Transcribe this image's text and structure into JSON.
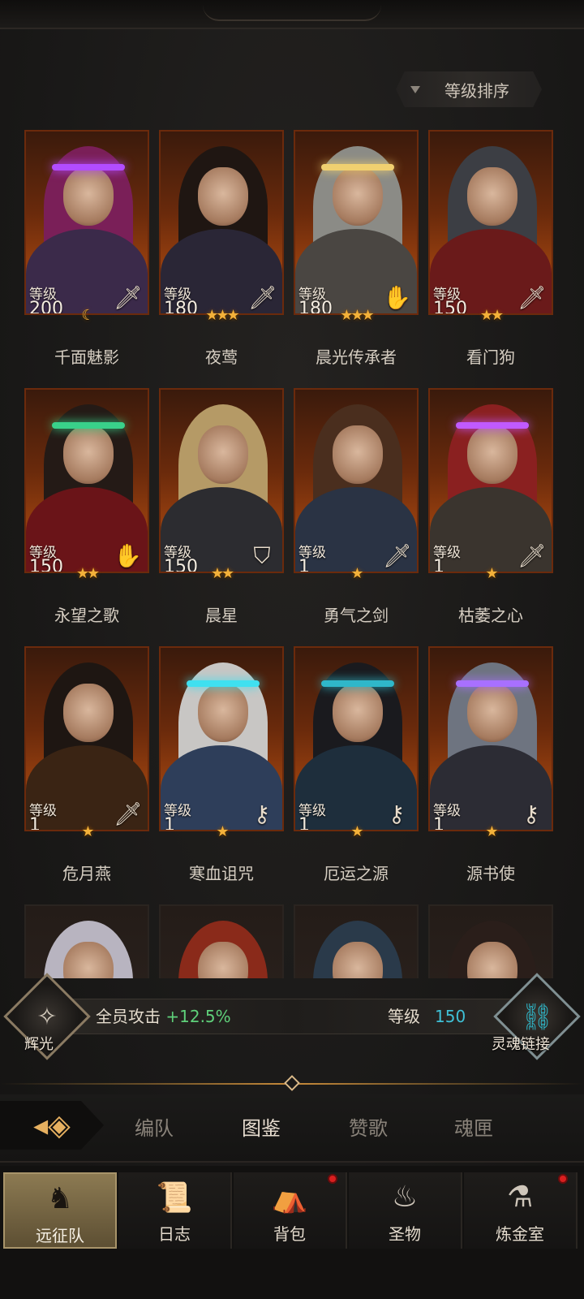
{
  "sort": {
    "label": "等级排序"
  },
  "level_label": "等级",
  "heroes": [
    {
      "name": "千面魅影",
      "level": "200",
      "class_icon": "dagger-icon",
      "stars": "☾",
      "hair": "#7a1f58",
      "armor": "#3b2a4a",
      "accent": "#b24cff"
    },
    {
      "name": "夜莺",
      "level": "180",
      "class_icon": "dagger-icon",
      "stars": "★★★",
      "hair": "#1f1612",
      "armor": "#2a2636",
      "accent": "transparent"
    },
    {
      "name": "晨光传承者",
      "level": "180",
      "class_icon": "palm-icon",
      "stars": "★★★",
      "hair": "#8b8b86",
      "armor": "#4a4642",
      "accent": "#f0d070"
    },
    {
      "name": "看门狗",
      "level": "150",
      "class_icon": "dagger-icon",
      "stars": "★★",
      "hair": "#3c3e44",
      "armor": "#6a1a1a",
      "accent": "transparent"
    },
    {
      "name": "永望之歌",
      "level": "150",
      "class_icon": "palm-icon",
      "stars": "★★",
      "hair": "#241a16",
      "armor": "#6a1418",
      "accent": "#39d18a"
    },
    {
      "name": "晨星",
      "level": "150",
      "class_icon": "shield-icon",
      "stars": "★★",
      "hair": "#b59a66",
      "armor": "#2c2c30",
      "accent": "transparent"
    },
    {
      "name": "勇气之剑",
      "level": "1",
      "class_icon": "sword-icon",
      "stars": "★",
      "hair": "#4a2e1e",
      "armor": "#2a3344",
      "accent": "transparent"
    },
    {
      "name": "枯萎之心",
      "level": "1",
      "class_icon": "sword-icon",
      "stars": "★",
      "hair": "#8a2020",
      "armor": "#3a342e",
      "accent": "#c05aff"
    },
    {
      "name": "危月燕",
      "level": "1",
      "class_icon": "sword-icon",
      "stars": "★",
      "hair": "#1e1612",
      "armor": "#3a2414",
      "accent": "transparent"
    },
    {
      "name": "寒血诅咒",
      "level": "1",
      "class_icon": "key-icon",
      "stars": "★",
      "hair": "#c8c6c4",
      "armor": "#2e3e5a",
      "accent": "#3fe0f0"
    },
    {
      "name": "厄运之源",
      "level": "1",
      "class_icon": "key-icon",
      "stars": "★",
      "hair": "#1a1a1e",
      "armor": "#1e2e3c",
      "accent": "#2fb7c9"
    },
    {
      "name": "源书使",
      "level": "1",
      "class_icon": "key-icon",
      "stars": "★",
      "hair": "#6e7480",
      "armor": "#2c2c34",
      "accent": "#a870ff"
    }
  ],
  "peek_heroes": [
    {
      "hair": "#b8b4c0",
      "armor": "#2a2230"
    },
    {
      "hair": "#8a2a1a",
      "armor": "#3a2418"
    },
    {
      "hair": "#2a3a4a",
      "armor": "#1a2a3a"
    },
    {
      "hair": "#2a1e1a",
      "armor": "#1e1a18"
    }
  ],
  "bonus": {
    "left_emblem_label": "辉光",
    "attack_text": "全员攻击",
    "attack_value": "+12.5%",
    "level_label": "等级",
    "level_value": "150",
    "right_emblem_label": "灵魂链接"
  },
  "tabs": [
    {
      "label": "编队",
      "active": false
    },
    {
      "label": "图鉴",
      "active": true
    },
    {
      "label": "赞歌",
      "active": false
    },
    {
      "label": "魂匣",
      "active": false
    }
  ],
  "nav": [
    {
      "label": "远征队",
      "icon": "horned-helmet-icon",
      "active": true,
      "dot": false
    },
    {
      "label": "日志",
      "icon": "scroll-icon",
      "active": false,
      "dot": false
    },
    {
      "label": "背包",
      "icon": "bag-icon",
      "active": false,
      "dot": true
    },
    {
      "label": "圣物",
      "icon": "torch-icon",
      "active": false,
      "dot": false
    },
    {
      "label": "炼金室",
      "icon": "alchemy-icon",
      "active": false,
      "dot": true
    }
  ]
}
